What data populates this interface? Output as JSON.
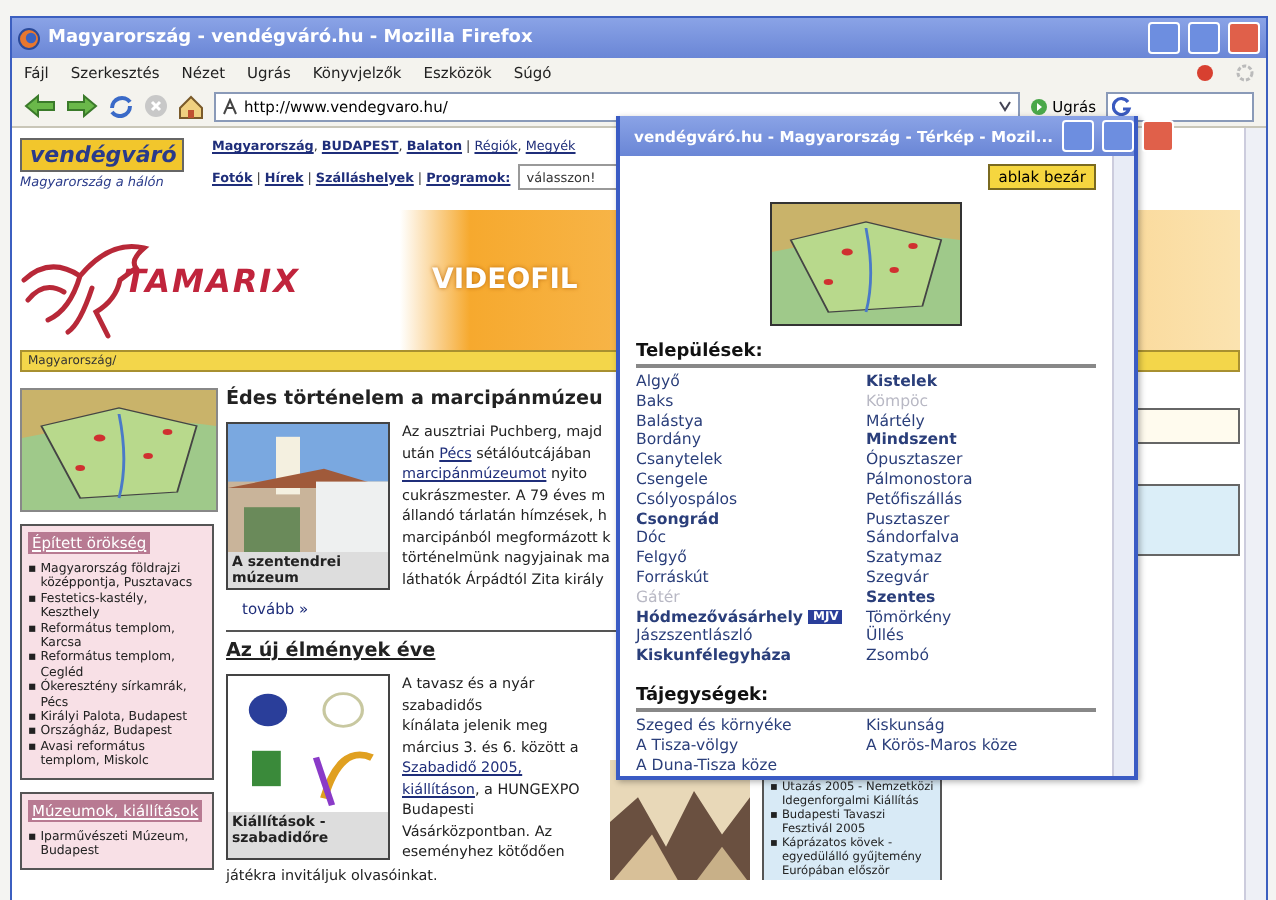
{
  "browser": {
    "title": "Magyarország - vendégváró.hu - Mozilla Firefox",
    "menu": [
      "Fájl",
      "Szerkesztés",
      "Nézet",
      "Ugrás",
      "Könyvjelzők",
      "Eszközök",
      "Súgó"
    ],
    "url": "http://www.vendegvaro.hu/",
    "go_label": "Ugrás"
  },
  "header": {
    "logo": "vendégváró",
    "tagline": "Magyarország a hálón",
    "nav_rows": [
      [
        {
          "text": "Magyarország",
          "link": true,
          "bold": true
        },
        {
          "text": ", "
        },
        {
          "text": "BUDAPEST",
          "link": true,
          "bold": true
        },
        {
          "text": ", "
        },
        {
          "text": "Balaton",
          "link": true,
          "bold": true
        },
        {
          "text": " | "
        },
        {
          "text": "Régiók",
          "link": true
        },
        {
          "text": ", "
        },
        {
          "text": "Megyék",
          "link": true
        }
      ],
      [
        {
          "text": "Fotók",
          "link": true,
          "bold": true
        },
        {
          "text": " | "
        },
        {
          "text": "Hírek",
          "link": true,
          "bold": true
        },
        {
          "text": " | "
        },
        {
          "text": "Szálláshelyek",
          "link": true,
          "bold": true
        },
        {
          "text": " | "
        },
        {
          "text": "Programok:",
          "link": true,
          "bold": true
        }
      ]
    ],
    "program_select": "válasszon!"
  },
  "banner": {
    "brand": "TAMARIX",
    "text": "VIDEOFIL"
  },
  "breadcrumb": "Magyarország/",
  "side_boxes": [
    {
      "title": "Épített örökség",
      "bullet": "▪",
      "items": [
        "Magyarország földrajzi középpontja, Pusztavacs",
        "Festetics-kastély, Keszthely",
        "Református templom, Karcsa",
        "Református templom, Cegléd",
        "Ókeresztény sírkamrák, Pécs",
        "Királyi Palota, Budapest",
        "Országház, Budapest",
        "Avasi református templom, Miskolc"
      ]
    },
    {
      "title": "Múzeumok, kiállítások",
      "bullet": "▪",
      "items": [
        "Iparművészeti Múzeum, Budapest"
      ]
    }
  ],
  "articles": [
    {
      "title": "Édes történelem a marcipánmúzeu",
      "caption": "A szentendrei múzeum",
      "lines": [
        [
          {
            "text": "Az ausztriai Puchberg, majd"
          }
        ],
        [
          {
            "text": "után "
          },
          {
            "text": "Pécs",
            "link": true
          },
          {
            "text": " sétálóutcájában"
          }
        ],
        [
          {
            "text": "marcipánmúzeumot",
            "link": true
          },
          {
            "text": " nyito"
          }
        ],
        [
          {
            "text": "cukrászmester. A 79 éves m"
          }
        ],
        [
          {
            "text": "állandó tárlatán hímzések, h"
          }
        ],
        [
          {
            "text": "marcipánból megformázott k"
          }
        ],
        [
          {
            "text": "történelmünk nagyjainak ma"
          }
        ],
        [
          {
            "text": "láthatók Árpádtól Zita király"
          }
        ]
      ],
      "more": "tovább »"
    },
    {
      "title": "Az új élmények éve",
      "caption": "Kiállítások - szabadidőre",
      "lines": [
        [
          {
            "text": "A tavasz és a nyár"
          }
        ],
        [
          {
            "text": "szabadidős"
          }
        ],
        [
          {
            "text": "kínálata jelenik meg"
          }
        ],
        [
          {
            "text": "március 3. és 6. között a"
          }
        ],
        [
          {
            "text": "Szabadidő 2005,",
            "link": true
          }
        ],
        [
          {
            "text": "kiállításon",
            "link": true
          },
          {
            "text": ", a HUNGEXPO"
          }
        ],
        [
          {
            "text": "Budapesti"
          }
        ],
        [
          {
            "text": "Vásárközpontban. Az"
          }
        ],
        [
          {
            "text": "eseményhez kötődően"
          }
        ]
      ],
      "tail": "játékra invitáljuk olvasóinkat."
    }
  ],
  "events": {
    "bullet": "▪",
    "items": [
      "Utazás 2005 - Nemzetközi Idegenforgalmi Kiállítás",
      "Budapesti Tavaszi Fesztivál 2005",
      "Káprázatos kövek - egyedülálló gyűjtemény Európában először"
    ]
  },
  "popup": {
    "title": "vendégváró.hu - Magyarország - Térkép - Mozil...",
    "close_button": "ablak bezár",
    "sections": [
      {
        "heading": "Települések:",
        "columns": [
          [
            {
              "name": "Algyő",
              "kind": "village"
            },
            {
              "name": "Baks",
              "kind": "village"
            },
            {
              "name": "Balástya",
              "kind": "village"
            },
            {
              "name": "Bordány",
              "kind": "village"
            },
            {
              "name": "Csanytelek",
              "kind": "village"
            },
            {
              "name": "Csengele",
              "kind": "village"
            },
            {
              "name": "Csólyospálos",
              "kind": "village"
            },
            {
              "name": "Csongrád",
              "kind": "city"
            },
            {
              "name": "Dóc",
              "kind": "village"
            },
            {
              "name": "Felgyő",
              "kind": "village"
            },
            {
              "name": "Forráskút",
              "kind": "village"
            },
            {
              "name": "Gátér",
              "kind": "inactive"
            },
            {
              "name": "Hódmezővásárhely",
              "kind": "city",
              "badge": "MJV"
            },
            {
              "name": "Jászszentlászló",
              "kind": "village"
            },
            {
              "name": "Kiskunfélegyháza",
              "kind": "city"
            }
          ],
          [
            {
              "name": "Kistelek",
              "kind": "city"
            },
            {
              "name": "Kömpöc",
              "kind": "inactive"
            },
            {
              "name": "Mártély",
              "kind": "village"
            },
            {
              "name": "Mindszent",
              "kind": "city"
            },
            {
              "name": "Ópusztaszer",
              "kind": "village"
            },
            {
              "name": "Pálmonostora",
              "kind": "village"
            },
            {
              "name": "Petőfiszállás",
              "kind": "village"
            },
            {
              "name": "Pusztaszer",
              "kind": "village"
            },
            {
              "name": "Sándorfalva",
              "kind": "village"
            },
            {
              "name": "Szatymaz",
              "kind": "village"
            },
            {
              "name": "Szegvár",
              "kind": "village"
            },
            {
              "name": "Szentes",
              "kind": "city"
            },
            {
              "name": "Tömörkény",
              "kind": "village"
            },
            {
              "name": "Üllés",
              "kind": "village"
            },
            {
              "name": "Zsombó",
              "kind": "village"
            }
          ]
        ]
      },
      {
        "heading": "Tájegységek:",
        "columns": [
          [
            {
              "name": "Szeged és környéke",
              "kind": "village"
            },
            {
              "name": "A Tisza-völgy",
              "kind": "village"
            },
            {
              "name": "A Duna-Tisza köze",
              "kind": "village"
            }
          ],
          [
            {
              "name": "Kiskunság",
              "kind": "village"
            },
            {
              "name": "A Körös-Maros köze",
              "kind": "village"
            }
          ]
        ]
      }
    ]
  }
}
